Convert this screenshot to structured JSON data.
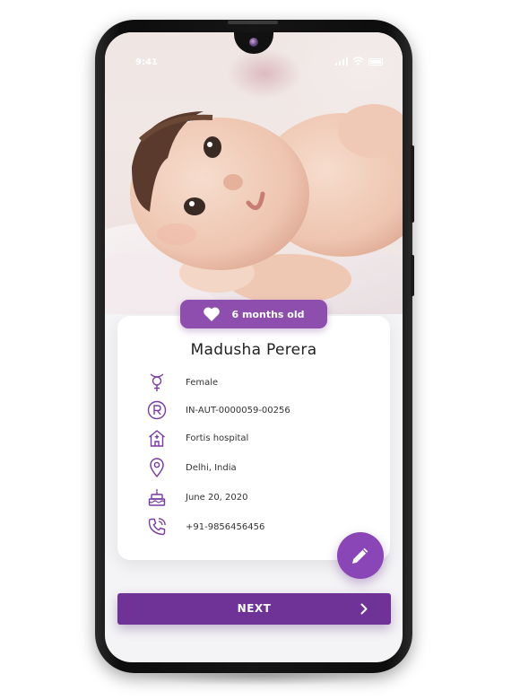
{
  "status_bar": {
    "time": "9:41",
    "icons": [
      "signal-icon",
      "wifi-icon",
      "battery-icon"
    ]
  },
  "hero": {
    "image": "baby-photo",
    "age_badge": "6 months old",
    "badge_icon": "heart-icon"
  },
  "profile": {
    "name": "Madusha Perera",
    "details": [
      {
        "icon": "gender-icon",
        "label": "Female"
      },
      {
        "icon": "registration-icon",
        "label": "IN-AUT-0000059-00256"
      },
      {
        "icon": "hospital-icon",
        "label": "Fortis hospital"
      },
      {
        "icon": "location-pin-icon",
        "label": "Delhi, India"
      },
      {
        "icon": "birthday-cake-icon",
        "label": "June 20, 2020"
      },
      {
        "icon": "phone-icon",
        "label": "+91-9856456456"
      }
    ]
  },
  "actions": {
    "edit_icon": "pencil-icon",
    "next_label": "NEXT",
    "next_icon": "chevron-right-icon"
  },
  "colors": {
    "primary": "#6f3398",
    "accent": "#8e4ead",
    "icon": "#7a3aa3"
  }
}
